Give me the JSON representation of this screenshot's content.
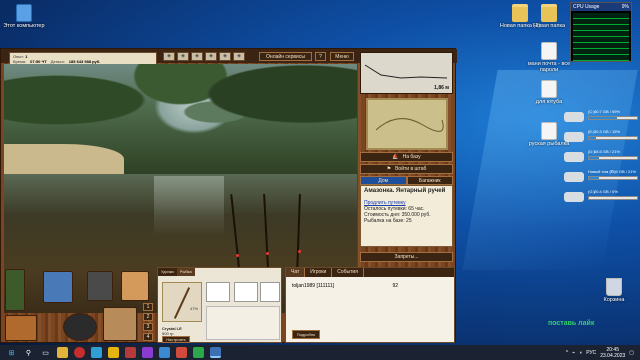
{
  "desktop": {
    "icons_left": [
      {
        "label": "Этот компьютер"
      }
    ],
    "icons_right": [
      {
        "label": "Новая папка (2)",
        "type": "folder"
      },
      {
        "label": "Новая папка",
        "type": "folder"
      },
      {
        "label": "мани почта - все пароли",
        "type": "doc"
      },
      {
        "label": "для ютуба",
        "type": "doc"
      },
      {
        "label": "руская рыбалка",
        "type": "doc"
      },
      {
        "label": "Корзина",
        "type": "bin"
      }
    ],
    "drives": [
      {
        "label": "(C:)",
        "detail": "40.7 GB / 59%",
        "fill": 0.59
      },
      {
        "label": "(E:)",
        "detail": "30.3 GB / 15%",
        "fill": 0.15
      },
      {
        "label": "(D:)",
        "detail": "68.5 GB / 21%",
        "fill": 0.21
      },
      {
        "label": "Новый том (F:)",
        "detail": "72.9 GB / 21%",
        "fill": 0.21
      },
      {
        "label": "(G:)",
        "detail": "20.4 GB / 0%",
        "fill": 0.0
      }
    ],
    "watermark": "поставь лайк",
    "gadget": {
      "title": "CPU Usage",
      "value": "9%"
    }
  },
  "game": {
    "info": {
      "experience_label": "Опыт:",
      "experience_value": "1",
      "time_label": "Время:",
      "time_value": "07:50 ЧТ",
      "money_label": "Деньги:",
      "money_value": "185 643 988 руб."
    },
    "top_buttons": {
      "online": "Онлайн сервисы",
      "help": "?",
      "menu": "Меню"
    },
    "depth": "1,86 м",
    "map_buttons": {
      "base": "На базу",
      "camp": "Войти в штаб"
    },
    "right_tabs": [
      {
        "label": "Дом",
        "active": true
      },
      {
        "label": "Багажник",
        "active": false
      }
    ],
    "location": {
      "title": "Амазонка. Янтарный ручей",
      "extend_link": "Продлить путевку",
      "remaining": "Осталось путевки: 65 час.",
      "cost": "Стоимость дня: 350.000 руб.",
      "fish_count": "Рыбалка на базе: 25"
    },
    "bans_button": "Запреты...",
    "tackle": {
      "rod_name": "Crystal LE",
      "rod_weight": "500 гр",
      "setup_button": "Настроить",
      "pct": "47%",
      "tabs": [
        "Удочки",
        "Рыбка"
      ]
    },
    "chat": {
      "tabs": [
        {
          "label": "Чат",
          "active": true
        },
        {
          "label": "Игроки",
          "active": false
        },
        {
          "label": "События",
          "active": false
        }
      ],
      "rows": [
        {
          "name": "toljan1989 [111111]",
          "value": "92"
        }
      ],
      "details_button": "Подробно"
    },
    "bottom_slots": [
      "1",
      "2",
      "3",
      "4"
    ]
  },
  "taskbar": {
    "time": "20:45",
    "date": "23.04.2023",
    "lang": "РУС"
  }
}
